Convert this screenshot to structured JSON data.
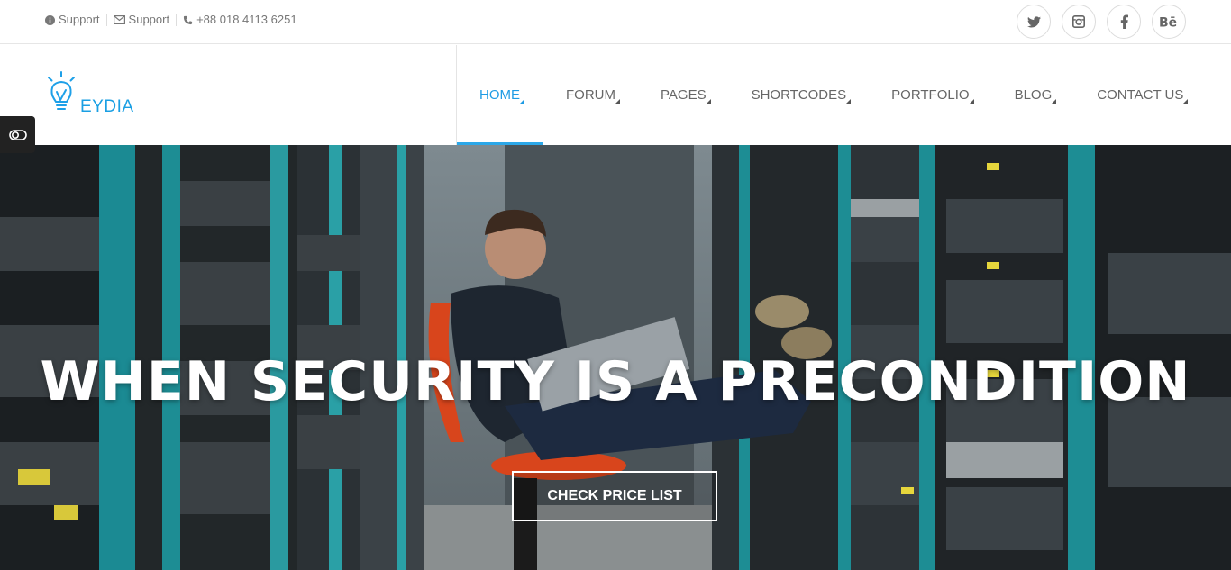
{
  "topbar": {
    "items": [
      {
        "icon": "info-circle-icon",
        "label": "Support"
      },
      {
        "icon": "envelope-icon",
        "label": "Support"
      },
      {
        "icon": "phone-icon",
        "label": "+88 018 4113 6251"
      }
    ],
    "social": [
      {
        "icon": "twitter-icon",
        "glyph": "🐦"
      },
      {
        "icon": "instagram-icon",
        "glyph": "◙"
      },
      {
        "icon": "facebook-icon",
        "glyph": "f"
      },
      {
        "icon": "behance-icon",
        "glyph": "Bē"
      }
    ]
  },
  "logo": {
    "text": "EYDIA"
  },
  "nav": {
    "items": [
      {
        "label": "HOME",
        "active": true
      },
      {
        "label": "FORUM"
      },
      {
        "label": "PAGES"
      },
      {
        "label": "SHORTCODES"
      },
      {
        "label": "PORTFOLIO"
      },
      {
        "label": "BLOG"
      },
      {
        "label": "CONTACT US"
      }
    ]
  },
  "hero": {
    "title": "WHEN SECURITY IS A PRECONDITION",
    "cta": "CHECK PRICE LIST"
  },
  "colors": {
    "accent": "#1e9be4",
    "hero_overlay": "#3c4a52",
    "rack_teal": "#1c8a8f"
  }
}
